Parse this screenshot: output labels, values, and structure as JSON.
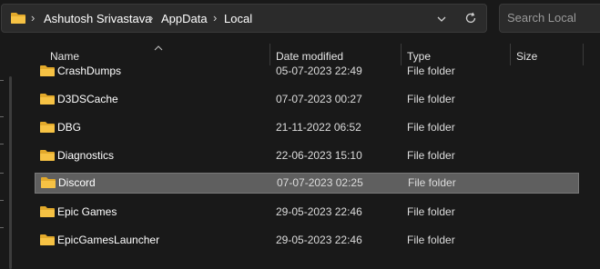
{
  "address_bar": {
    "breadcrumbs": [
      "Ashutosh Srivastava",
      "AppData",
      "Local"
    ]
  },
  "search": {
    "placeholder": "Search Local"
  },
  "columns": {
    "name": "Name",
    "date_modified": "Date modified",
    "type": "Type",
    "size": "Size"
  },
  "files": [
    {
      "name": "CrashDumps",
      "date": "05-07-2023 22:49",
      "type": "File folder",
      "selected": false
    },
    {
      "name": "D3DSCache",
      "date": "07-07-2023 00:27",
      "type": "File folder",
      "selected": false
    },
    {
      "name": "DBG",
      "date": "21-11-2022 06:52",
      "type": "File folder",
      "selected": false
    },
    {
      "name": "Diagnostics",
      "date": "22-06-2023 15:10",
      "type": "File folder",
      "selected": false
    },
    {
      "name": "Discord",
      "date": "07-07-2023 02:25",
      "type": "File folder",
      "selected": true
    },
    {
      "name": "Epic Games",
      "date": "29-05-2023 22:46",
      "type": "File folder",
      "selected": false
    },
    {
      "name": "EpicGamesLauncher",
      "date": "29-05-2023 22:46",
      "type": "File folder",
      "selected": false
    }
  ],
  "colors": {
    "folder": "#f6c244",
    "folder_dark": "#e2a92b",
    "selection": "#5f5f5f"
  },
  "icons": [
    "folder-icon",
    "chevron-right-icon",
    "chevron-down-icon",
    "refresh-icon",
    "sort-up-icon"
  ]
}
